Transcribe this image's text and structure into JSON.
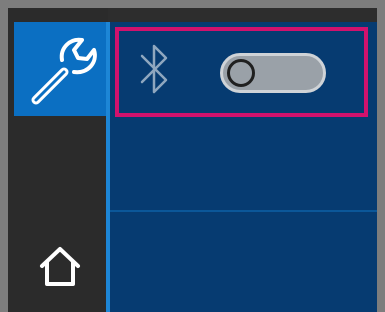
{
  "sidebar": {
    "items": [
      {
        "name": "settings",
        "icon": "wrench-icon",
        "selected": true
      },
      {
        "name": "home",
        "icon": "home-icon",
        "selected": false
      }
    ]
  },
  "settings": {
    "bluetooth": {
      "icon": "bluetooth-icon",
      "toggle_state": "off",
      "highlighted": true,
      "highlight_color": "#d1126d"
    }
  },
  "colors": {
    "sidebar_bg": "#2b2b2b",
    "selected_tab": "#0b6fc2",
    "content_bg": "#063b71",
    "frame": "#7d7d7d"
  }
}
